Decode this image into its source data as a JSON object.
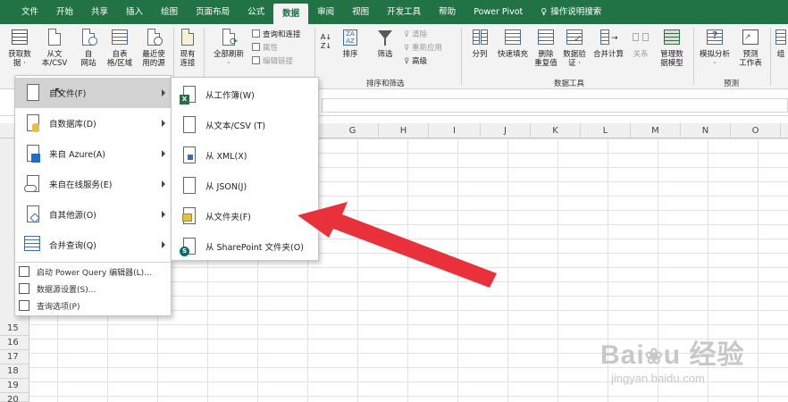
{
  "ribbon_tabs": [
    "文件",
    "开始",
    "共享",
    "插入",
    "绘图",
    "页面布局",
    "公式",
    "数据",
    "审阅",
    "视图",
    "开发工具",
    "帮助",
    "Power Pivot",
    "操作说明搜索"
  ],
  "active_tab_index": 7,
  "ribbon": {
    "get_data": "获取数\n据 ·",
    "from_text_csv": "从文\n本/CSV",
    "from_web": "自\n网站",
    "from_table": "自表\n格/区域",
    "recent_sources": "最近使\n用的源",
    "existing_connections": "现有\n连接",
    "refresh_all": "全部刷新\n·",
    "queries_connections": "查询和连接",
    "properties": "属性",
    "edit_links": "编辑链接",
    "sort": "排序",
    "filter": "筛选",
    "clear": "清除",
    "reapply": "重新应用",
    "advanced": "高级",
    "sort_filter_group": "排序和筛选",
    "text_to_columns": "分列",
    "flash_fill": "快速填充",
    "remove_duplicates": "删除\n重复值",
    "data_validation": "数据验\n证 ·",
    "consolidate": "合并计算",
    "relationships": "关系",
    "manage_data_model": "管理数\n据模型",
    "data_tools_group": "数据工具",
    "what_if": "模拟分析\n·",
    "forecast_sheet": "预测\n工作表",
    "forecast_group": "预测",
    "outline_partial": "组"
  },
  "columns": [
    "G",
    "H",
    "I",
    "J",
    "K",
    "L",
    "M",
    "N",
    "O"
  ],
  "rows": [
    "15",
    "16",
    "17",
    "18",
    "19",
    "20"
  ],
  "get_data_menu": {
    "items": [
      {
        "label": "自文件(F)",
        "icon": "file-icon",
        "has_submenu": true,
        "highlighted": true
      },
      {
        "label": "自数据库(D)",
        "icon": "database-icon",
        "has_submenu": true
      },
      {
        "label": "来自 Azure(A)",
        "icon": "azure-icon",
        "has_submenu": true
      },
      {
        "label": "来自在线服务(E)",
        "icon": "cloud-icon",
        "has_submenu": true
      },
      {
        "label": "自其他源(O)",
        "icon": "other-sources-icon",
        "has_submenu": true
      },
      {
        "label": "合并查询(Q)",
        "icon": "combine-queries-icon",
        "has_submenu": true
      }
    ],
    "small_items": [
      "启动 Power Query 编辑器(L)...",
      "数据源设置(S)...",
      "查询选项(P)"
    ]
  },
  "from_file_submenu": {
    "items": [
      {
        "label": "从工作簿(W)",
        "icon": "excel-workbook-icon"
      },
      {
        "label": "从文本/CSV (T)",
        "icon": "text-csv-icon"
      },
      {
        "label": "从 XML(X)",
        "icon": "xml-icon"
      },
      {
        "label": "从 JSON(J)",
        "icon": "json-icon"
      },
      {
        "label": "从文件夹(F)",
        "icon": "folder-icon"
      },
      {
        "label": "从 SharePoint 文件夹(O)",
        "icon": "sharepoint-icon"
      }
    ]
  },
  "colors": {
    "accent": "#217346",
    "annotation_arrow": "#e8313b"
  }
}
